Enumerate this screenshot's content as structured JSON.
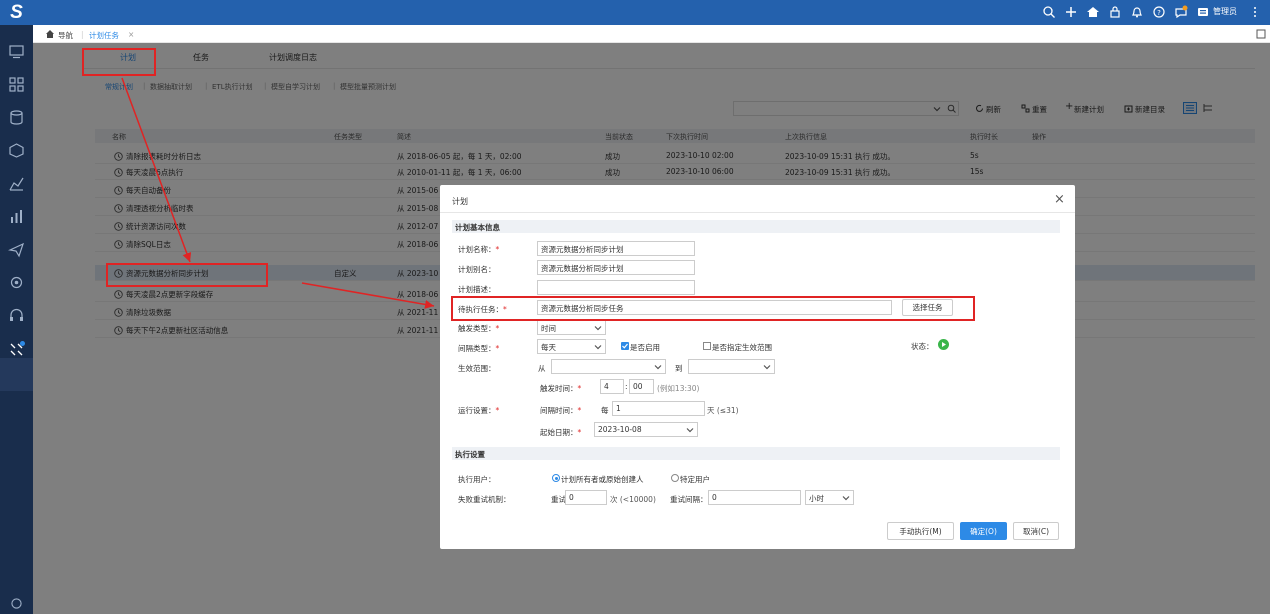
{
  "topbar": {
    "logo": "S",
    "user": "管理员"
  },
  "breadcrumb": {
    "home": "导航",
    "tab": "计划任务",
    "close": "×"
  },
  "segments": [
    "计划",
    "任务",
    "计划调度日志"
  ],
  "subtabs": [
    "常规计划",
    "数据抽取计划",
    "ETL执行计划",
    "模型自学习计划",
    "模型批量预测计划"
  ],
  "toolbar": {
    "refresh": "刷新",
    "reset": "重置",
    "new_plan": "新建计划",
    "new_dir": "新建目录"
  },
  "table": {
    "headers": [
      "名称",
      "任务类型",
      "简述",
      "当前状态",
      "下次执行时间",
      "上次执行信息",
      "执行时长",
      "操作"
    ],
    "rows": [
      {
        "name": "清除报表耗时分析日志",
        "type": "",
        "desc": "从 2018-06-05 起，每 1 天，02:00",
        "status": "成功",
        "next": "2023-10-10 02:00",
        "last": "2023-10-09 15:31 执行 成功。",
        "dur": "5s"
      },
      {
        "name": "每天凌晨6点执行",
        "type": "",
        "desc": "从 2010-01-11 起，每 1 天，06:00",
        "status": "成功",
        "next": "2023-10-10 06:00",
        "last": "2023-10-09 15:31 执行 成功。",
        "dur": "15s"
      },
      {
        "name": "每天自动备份",
        "type": "",
        "desc": "从 2015-06",
        "status": "",
        "next": "",
        "last": "",
        "dur": ""
      },
      {
        "name": "清理透视分析临时表",
        "type": "",
        "desc": "从 2015-08",
        "status": "",
        "next": "",
        "last": "",
        "dur": ""
      },
      {
        "name": "统计资源访问次数",
        "type": "",
        "desc": "从 2012-07",
        "status": "",
        "next": "",
        "last": "",
        "dur": ""
      },
      {
        "name": "清除SQL日志",
        "type": "",
        "desc": "从 2018-06",
        "status": "",
        "next": "",
        "last": "",
        "dur": ""
      },
      {
        "name": "资源元数据分析同步计划",
        "type": "自定义",
        "desc": "从 2023-10",
        "status": "",
        "next": "",
        "last": "",
        "dur": ""
      },
      {
        "name": "每天凌晨2点更新字段缓存",
        "type": "",
        "desc": "从 2018-06",
        "status": "",
        "next": "",
        "last": "",
        "dur": ""
      },
      {
        "name": "清除垃圾数据",
        "type": "",
        "desc": "从 2021-11",
        "status": "",
        "next": "",
        "last": "",
        "dur": ""
      },
      {
        "name": "每天下午2点更新社区活动信息",
        "type": "",
        "desc": "从 2021-11",
        "status": "",
        "next": "",
        "last": "",
        "dur": ""
      }
    ]
  },
  "dialog": {
    "title": "计划",
    "close": "×",
    "section_basic": "计划基本信息",
    "plan_name_label": "计划名称：",
    "plan_name": "资源元数据分析同步计划",
    "plan_alias_label": "计划别名：",
    "plan_alias": "资源元数据分析同步计划",
    "plan_desc_label": "计划描述：",
    "plan_desc": "",
    "task_label": "待执行任务：",
    "task": "资源元数据分析同步任务",
    "select_task": "选择任务",
    "trigger_type_label": "触发类型：",
    "trigger_type": "时间",
    "interval_type_label": "间隔类型：",
    "interval_type": "每天",
    "enabled": "是否启用",
    "specify_range": "是否指定生效范围",
    "state_label": "状态：",
    "effective_label": "生效范围：",
    "from": "从",
    "to": "到",
    "trigger_time_label": "触发时间：",
    "hour": "4",
    "minute": "00",
    "time_hint": "(例如13:30)",
    "run_label": "运行设置：",
    "interval_time_label": "间隔时间：",
    "every": "每",
    "every_value": "1",
    "day_hint": "天 (≤31)",
    "start_date_label": "起始日期：",
    "start_date": "2023-10-08",
    "section_exec": "执行设置",
    "exec_user_label": "执行用户：",
    "exec_user_opt1": "计划所有者或原始创建人",
    "exec_user_opt2": "特定用户",
    "retry_label": "失败重试机制：",
    "retry": "重试",
    "retry_value": "0",
    "retry_unit": "次 (<10000)",
    "retry_interval": "重试间隔：",
    "retry_interval_value": "0",
    "retry_interval_unit": "小时",
    "btn_manual": "手动执行(M)",
    "btn_ok": "确定(O)",
    "btn_cancel": "取消(C)"
  },
  "colors": {
    "topbar": "#2461ad",
    "sidebar": "#192d4c",
    "primary": "#2d8ae6",
    "annotation": "#e02424"
  }
}
